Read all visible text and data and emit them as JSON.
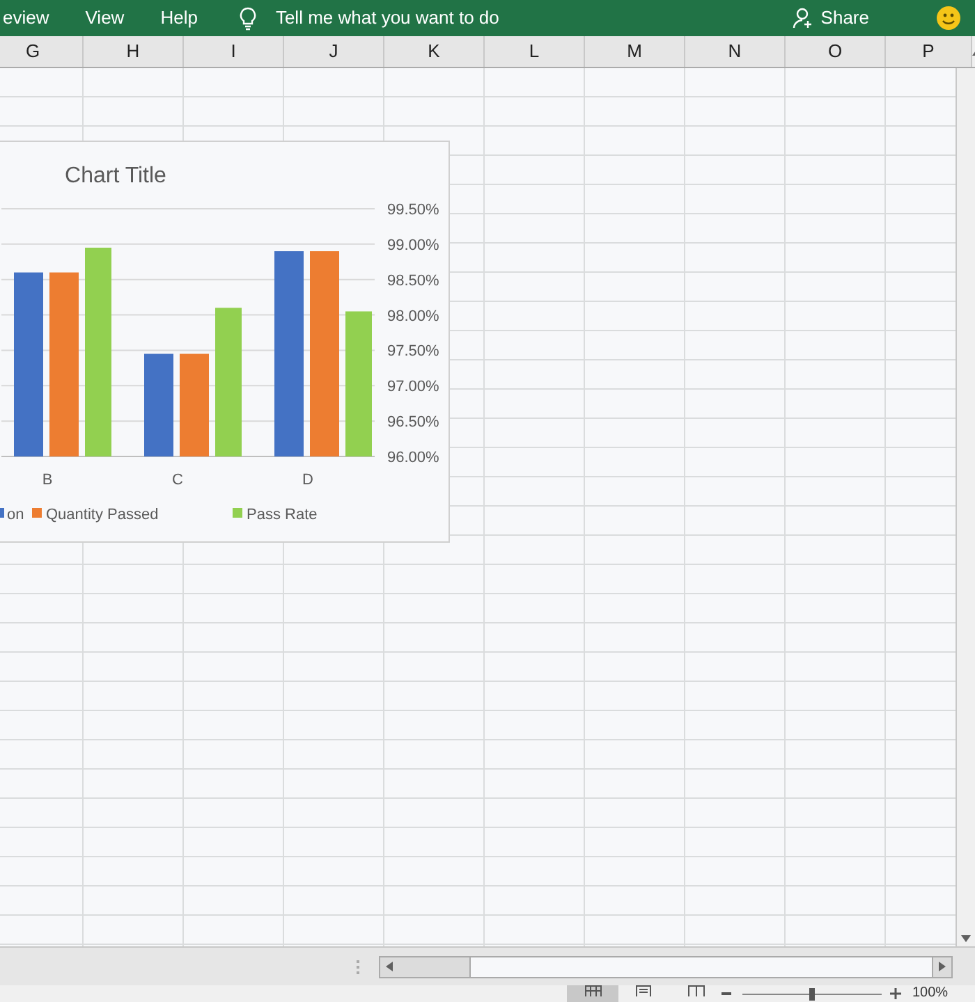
{
  "ribbon": {
    "tabs": [
      "eview",
      "View",
      "Help"
    ],
    "tell_me": "Tell me what you want to do",
    "share": "Share"
  },
  "columns": [
    "G",
    "H",
    "I",
    "J",
    "K",
    "L",
    "M",
    "N",
    "O",
    "P"
  ],
  "chart": {
    "title": "Chart Title",
    "chart_data": {
      "type": "bar",
      "grid": true,
      "legend": true,
      "categories": [
        "B",
        "C",
        "D"
      ],
      "ylim": [
        96,
        99.5
      ],
      "yticks": [
        {
          "value": 96,
          "label": "96.00%"
        },
        {
          "value": 96.5,
          "label": "96.50%"
        },
        {
          "value": 97,
          "label": "97.00%"
        },
        {
          "value": 97.5,
          "label": "97.50%"
        },
        {
          "value": 98,
          "label": "98.00%"
        },
        {
          "value": 98.5,
          "label": "98.50%"
        },
        {
          "value": 99,
          "label": "99.00%"
        },
        {
          "value": 99.5,
          "label": "99.50%"
        }
      ],
      "series": [
        {
          "name": "on",
          "color": "#4472c4",
          "values": [
            98.6,
            97.45,
            98.9
          ]
        },
        {
          "name": "Quantity Passed",
          "color": "#ed7d31",
          "values": [
            98.6,
            97.45,
            98.9
          ]
        },
        {
          "name": "Pass Rate",
          "color": "#92d050",
          "values": [
            98.95,
            98.1,
            98.05
          ]
        }
      ]
    }
  },
  "status_bar": {
    "zoom": "100%",
    "zoom_slider": {
      "level": 0.5
    }
  }
}
